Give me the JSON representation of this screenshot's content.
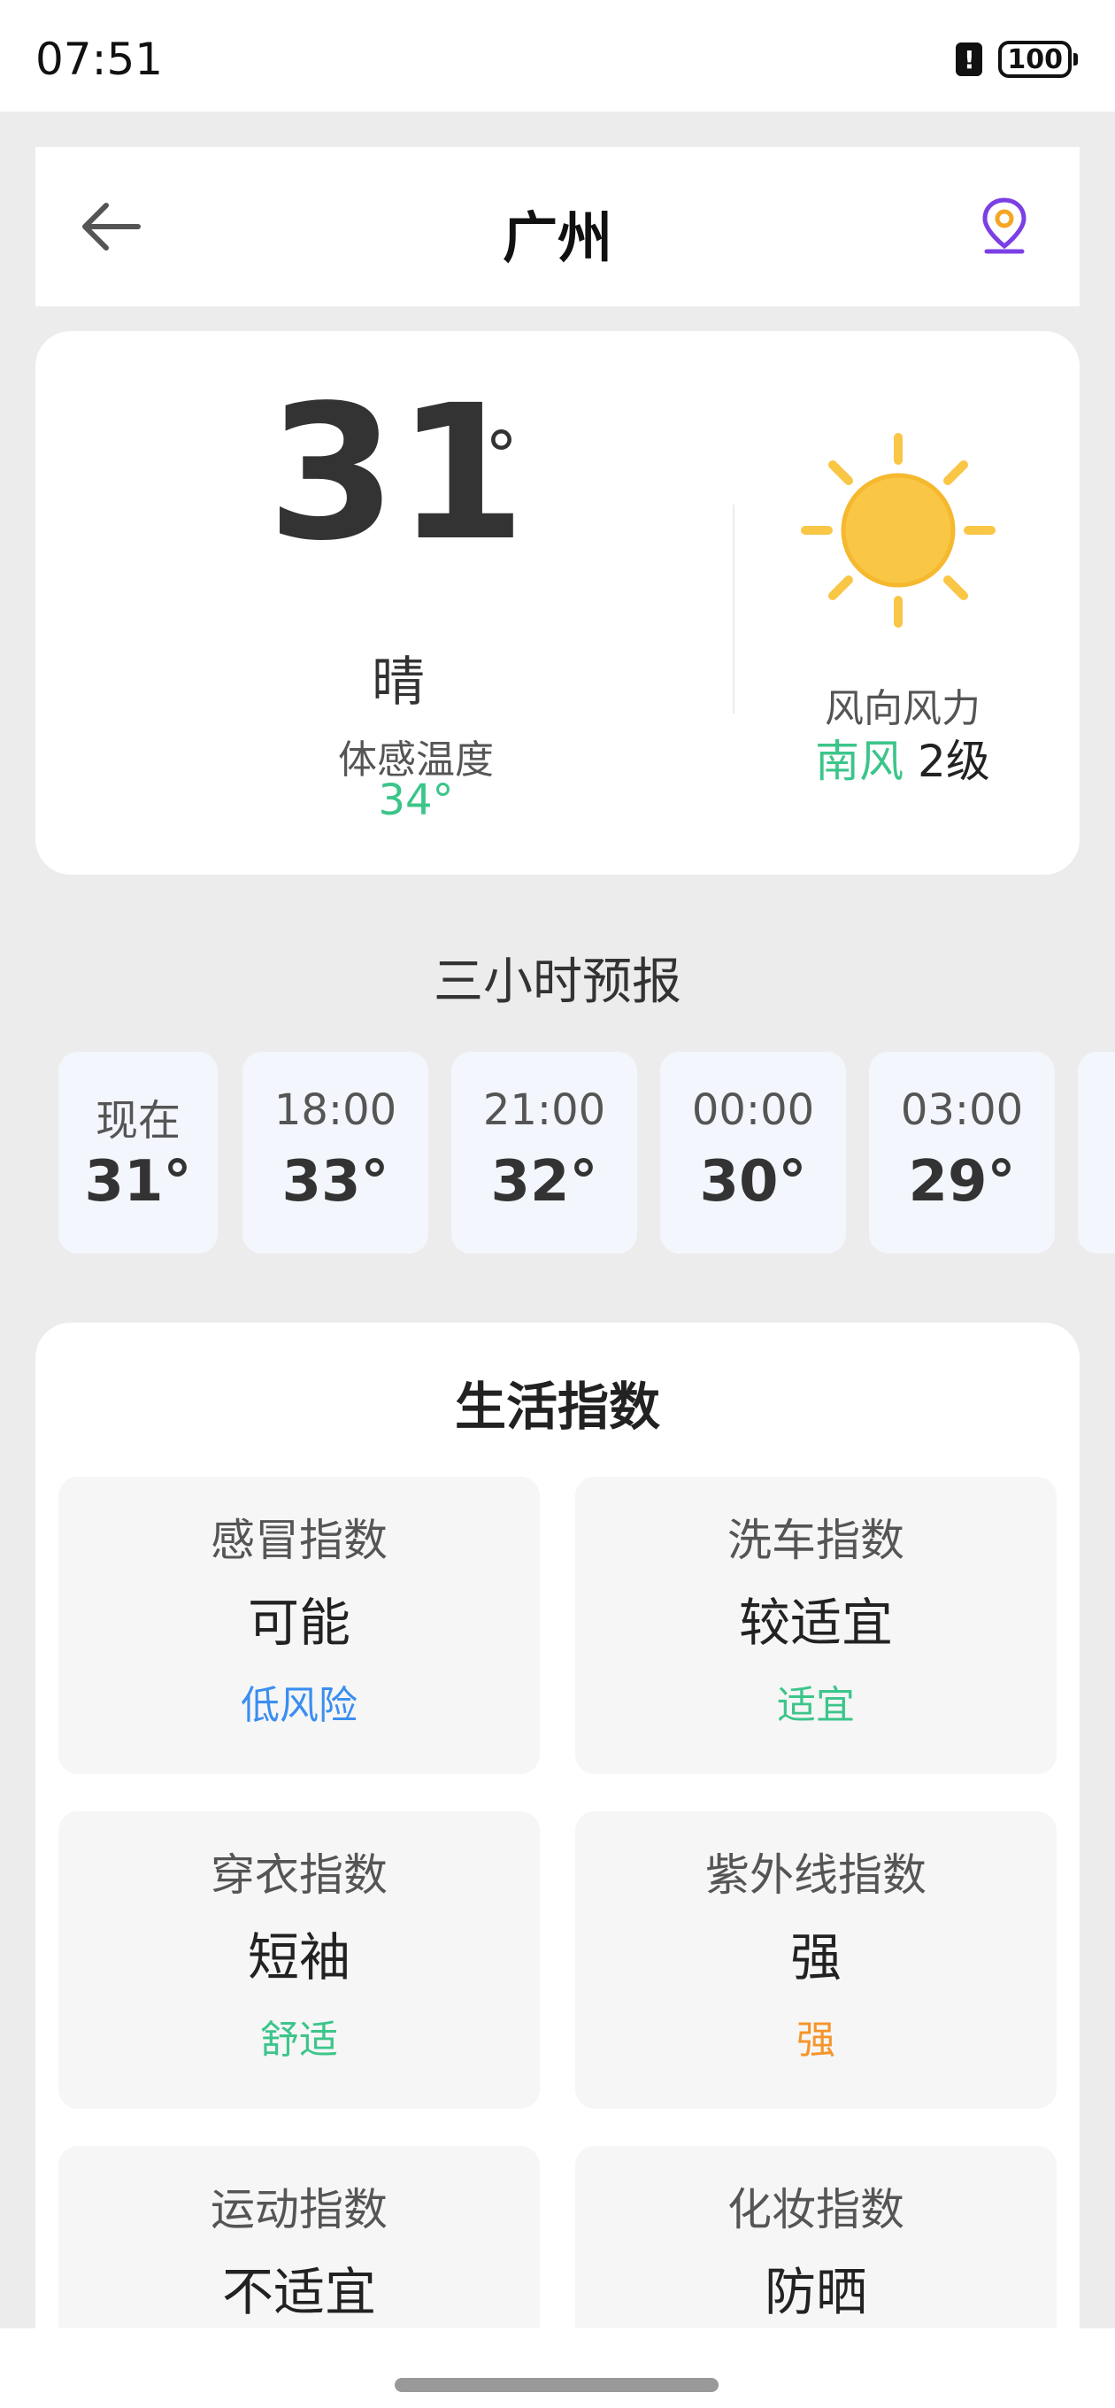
{
  "status_bar": {
    "time": "07:51",
    "battery": "100"
  },
  "header": {
    "title": "广州"
  },
  "current": {
    "temperature": "31",
    "degree": "°",
    "condition": "晴",
    "feels_like_label": "体感温度",
    "feels_like_value": "34°",
    "wind_label": "风向风力",
    "wind_direction": "南风",
    "wind_level": "2级",
    "icon": "sun-icon"
  },
  "forecast": {
    "title": "三小时预报",
    "items": [
      {
        "time": "现在",
        "temp": "31°"
      },
      {
        "time": "18:00",
        "temp": "33°"
      },
      {
        "time": "21:00",
        "temp": "32°"
      },
      {
        "time": "00:00",
        "temp": "30°"
      },
      {
        "time": "03:00",
        "temp": "29°"
      }
    ]
  },
  "life_index": {
    "title": "生活指数",
    "items": [
      {
        "name": "感冒指数",
        "value": "可能",
        "level": "低风险",
        "level_color": "#3b8ef0"
      },
      {
        "name": "洗车指数",
        "value": "较适宜",
        "level": "适宜",
        "level_color": "#3cc58a"
      },
      {
        "name": "穿衣指数",
        "value": "短袖",
        "level": "舒适",
        "level_color": "#3cc58a"
      },
      {
        "name": "紫外线指数",
        "value": "强",
        "level": "强",
        "level_color": "#f5952a"
      },
      {
        "name": "运动指数",
        "value": "不适宜",
        "level": "",
        "level_color": "#555555"
      },
      {
        "name": "化妆指数",
        "value": "防晒",
        "level": "",
        "level_color": "#555555"
      }
    ]
  },
  "colors": {
    "accent_green": "#3cc58a",
    "accent_blue": "#3b8ef0",
    "accent_orange": "#f5952a",
    "sun": "#f9c645",
    "location_icon": "#7b3fe4"
  }
}
